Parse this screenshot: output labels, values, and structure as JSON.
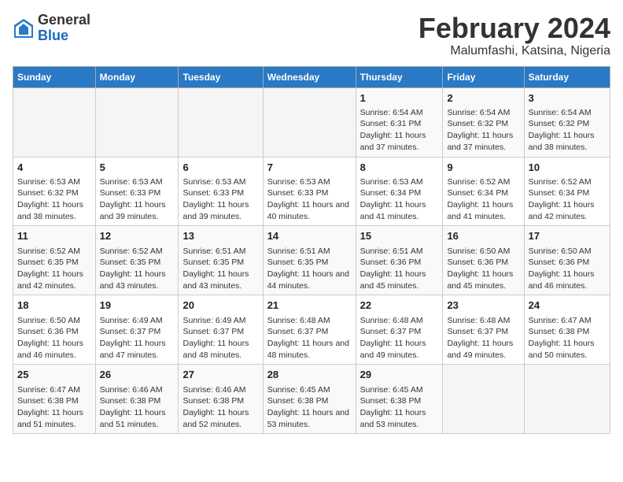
{
  "header": {
    "logo_general": "General",
    "logo_blue": "Blue",
    "month_year": "February 2024",
    "location": "Malumfashi, Katsina, Nigeria"
  },
  "columns": [
    "Sunday",
    "Monday",
    "Tuesday",
    "Wednesday",
    "Thursday",
    "Friday",
    "Saturday"
  ],
  "weeks": [
    [
      {
        "day": "",
        "info": ""
      },
      {
        "day": "",
        "info": ""
      },
      {
        "day": "",
        "info": ""
      },
      {
        "day": "",
        "info": ""
      },
      {
        "day": "1",
        "info": "Sunrise: 6:54 AM\nSunset: 6:31 PM\nDaylight: 11 hours and 37 minutes."
      },
      {
        "day": "2",
        "info": "Sunrise: 6:54 AM\nSunset: 6:32 PM\nDaylight: 11 hours and 37 minutes."
      },
      {
        "day": "3",
        "info": "Sunrise: 6:54 AM\nSunset: 6:32 PM\nDaylight: 11 hours and 38 minutes."
      }
    ],
    [
      {
        "day": "4",
        "info": "Sunrise: 6:53 AM\nSunset: 6:32 PM\nDaylight: 11 hours and 38 minutes."
      },
      {
        "day": "5",
        "info": "Sunrise: 6:53 AM\nSunset: 6:33 PM\nDaylight: 11 hours and 39 minutes."
      },
      {
        "day": "6",
        "info": "Sunrise: 6:53 AM\nSunset: 6:33 PM\nDaylight: 11 hours and 39 minutes."
      },
      {
        "day": "7",
        "info": "Sunrise: 6:53 AM\nSunset: 6:33 PM\nDaylight: 11 hours and 40 minutes."
      },
      {
        "day": "8",
        "info": "Sunrise: 6:53 AM\nSunset: 6:34 PM\nDaylight: 11 hours and 41 minutes."
      },
      {
        "day": "9",
        "info": "Sunrise: 6:52 AM\nSunset: 6:34 PM\nDaylight: 11 hours and 41 minutes."
      },
      {
        "day": "10",
        "info": "Sunrise: 6:52 AM\nSunset: 6:34 PM\nDaylight: 11 hours and 42 minutes."
      }
    ],
    [
      {
        "day": "11",
        "info": "Sunrise: 6:52 AM\nSunset: 6:35 PM\nDaylight: 11 hours and 42 minutes."
      },
      {
        "day": "12",
        "info": "Sunrise: 6:52 AM\nSunset: 6:35 PM\nDaylight: 11 hours and 43 minutes."
      },
      {
        "day": "13",
        "info": "Sunrise: 6:51 AM\nSunset: 6:35 PM\nDaylight: 11 hours and 43 minutes."
      },
      {
        "day": "14",
        "info": "Sunrise: 6:51 AM\nSunset: 6:35 PM\nDaylight: 11 hours and 44 minutes."
      },
      {
        "day": "15",
        "info": "Sunrise: 6:51 AM\nSunset: 6:36 PM\nDaylight: 11 hours and 45 minutes."
      },
      {
        "day": "16",
        "info": "Sunrise: 6:50 AM\nSunset: 6:36 PM\nDaylight: 11 hours and 45 minutes."
      },
      {
        "day": "17",
        "info": "Sunrise: 6:50 AM\nSunset: 6:36 PM\nDaylight: 11 hours and 46 minutes."
      }
    ],
    [
      {
        "day": "18",
        "info": "Sunrise: 6:50 AM\nSunset: 6:36 PM\nDaylight: 11 hours and 46 minutes."
      },
      {
        "day": "19",
        "info": "Sunrise: 6:49 AM\nSunset: 6:37 PM\nDaylight: 11 hours and 47 minutes."
      },
      {
        "day": "20",
        "info": "Sunrise: 6:49 AM\nSunset: 6:37 PM\nDaylight: 11 hours and 48 minutes."
      },
      {
        "day": "21",
        "info": "Sunrise: 6:48 AM\nSunset: 6:37 PM\nDaylight: 11 hours and 48 minutes."
      },
      {
        "day": "22",
        "info": "Sunrise: 6:48 AM\nSunset: 6:37 PM\nDaylight: 11 hours and 49 minutes."
      },
      {
        "day": "23",
        "info": "Sunrise: 6:48 AM\nSunset: 6:37 PM\nDaylight: 11 hours and 49 minutes."
      },
      {
        "day": "24",
        "info": "Sunrise: 6:47 AM\nSunset: 6:38 PM\nDaylight: 11 hours and 50 minutes."
      }
    ],
    [
      {
        "day": "25",
        "info": "Sunrise: 6:47 AM\nSunset: 6:38 PM\nDaylight: 11 hours and 51 minutes."
      },
      {
        "day": "26",
        "info": "Sunrise: 6:46 AM\nSunset: 6:38 PM\nDaylight: 11 hours and 51 minutes."
      },
      {
        "day": "27",
        "info": "Sunrise: 6:46 AM\nSunset: 6:38 PM\nDaylight: 11 hours and 52 minutes."
      },
      {
        "day": "28",
        "info": "Sunrise: 6:45 AM\nSunset: 6:38 PM\nDaylight: 11 hours and 53 minutes."
      },
      {
        "day": "29",
        "info": "Sunrise: 6:45 AM\nSunset: 6:38 PM\nDaylight: 11 hours and 53 minutes."
      },
      {
        "day": "",
        "info": ""
      },
      {
        "day": "",
        "info": ""
      }
    ]
  ]
}
